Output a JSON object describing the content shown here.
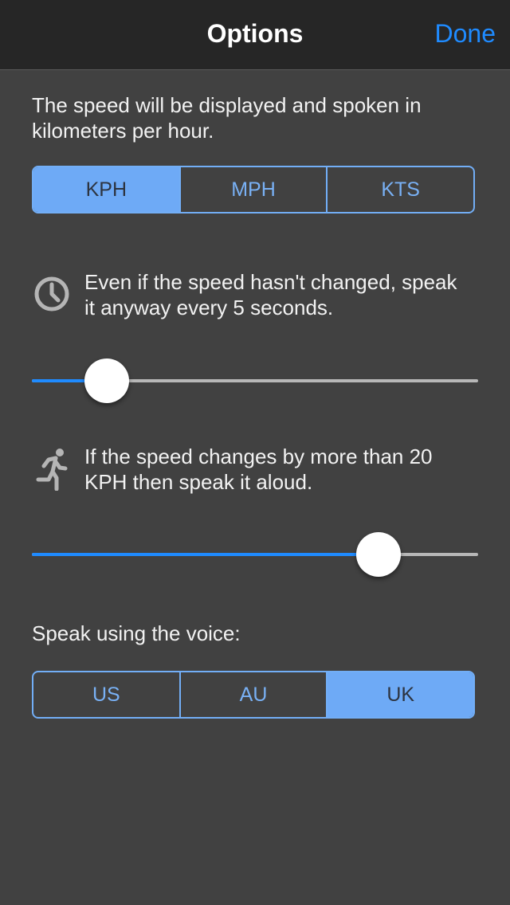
{
  "navbar": {
    "title": "Options",
    "done_label": "Done"
  },
  "units": {
    "description": "The speed will be displayed and spoken in kilometers per hour.",
    "options": [
      "KPH",
      "MPH",
      "KTS"
    ],
    "selected": "KPH"
  },
  "interval": {
    "icon": "clock-icon",
    "text": "Even if the speed hasn't changed, speak it anyway every 5 seconds.",
    "slider_fraction": 0.167
  },
  "change": {
    "icon": "running-person-icon",
    "text": "If the speed changes by more than 20 KPH then speak it aloud.",
    "slider_fraction": 0.777
  },
  "voice": {
    "label": "Speak using the voice:",
    "options": [
      "US",
      "AU",
      "UK"
    ],
    "selected": "UK"
  },
  "colors": {
    "accent": "#1f8bff",
    "segment_selected": "#6eaaf6",
    "background": "#414141",
    "navbar": "#262626"
  }
}
